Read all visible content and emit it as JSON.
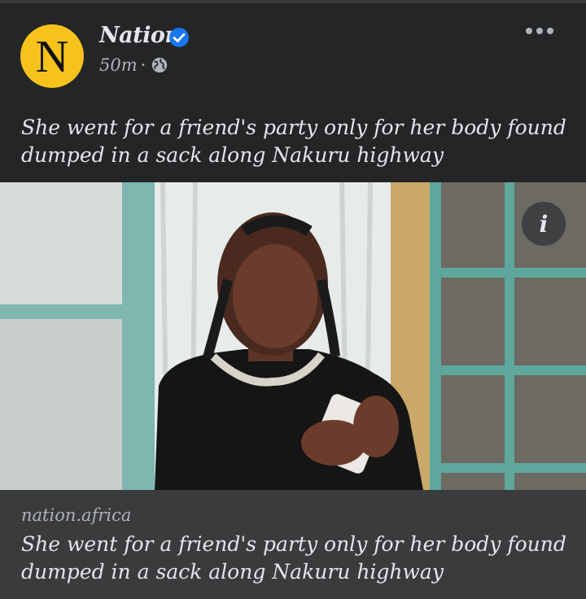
{
  "post": {
    "page_name": "Nation",
    "avatar_letter": "N",
    "time": "50m",
    "separator": "·",
    "privacy_icon": "globe-icon",
    "more_icon": "more-options-icon",
    "caption": "She went for a friend's party only for her body found dumped in a sack along Nakuru highway"
  },
  "link_preview": {
    "domain": "nation.africa",
    "title": "She went for a friend's party only for her body found dumped in a sack along Nakuru highway",
    "info_label": "i"
  },
  "colors": {
    "background": "#242526",
    "link_box": "#3a3b3c",
    "avatar": "#f5c31c",
    "verified": "#1877f2"
  }
}
